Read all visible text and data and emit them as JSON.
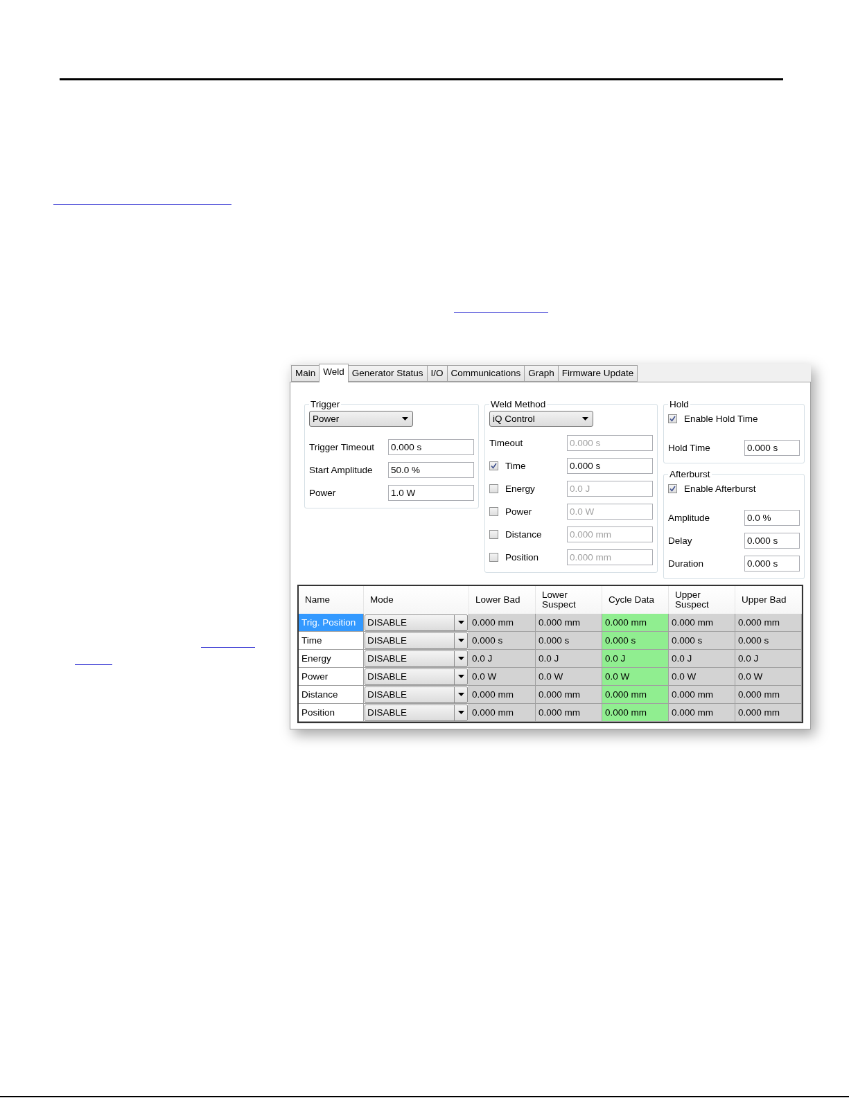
{
  "tabs": [
    {
      "label": "Main",
      "selected": false
    },
    {
      "label": "Weld",
      "selected": true
    },
    {
      "label": "Generator Status",
      "selected": false
    },
    {
      "label": "I/O",
      "selected": false
    },
    {
      "label": "Communications",
      "selected": false
    },
    {
      "label": "Graph",
      "selected": false
    },
    {
      "label": "Firmware Update",
      "selected": false
    }
  ],
  "trigger": {
    "title": "Trigger",
    "dropdown": "Power",
    "fields": [
      {
        "label": "Trigger Timeout",
        "value": "0.000 s"
      },
      {
        "label": "Start Amplitude",
        "value": "50.0 %"
      },
      {
        "label": "Power",
        "value": "1.0 W"
      }
    ]
  },
  "weld_method": {
    "title": "Weld Method",
    "dropdown": "iQ Control",
    "timeout": {
      "label": "Timeout",
      "value": "0.000 s",
      "disabled": true
    },
    "options": [
      {
        "label": "Time",
        "checked": true,
        "value": "0.000 s"
      },
      {
        "label": "Energy",
        "checked": false,
        "value": "0.0 J"
      },
      {
        "label": "Power",
        "checked": false,
        "value": "0.0 W"
      },
      {
        "label": "Distance",
        "checked": false,
        "value": "0.000 mm"
      },
      {
        "label": "Position",
        "checked": false,
        "value": "0.000 mm"
      }
    ]
  },
  "hold": {
    "title": "Hold",
    "checkbox": {
      "label": "Enable Hold Time",
      "checked": true
    },
    "fields": [
      {
        "label": "Hold Time",
        "value": "0.000 s"
      }
    ]
  },
  "afterburst": {
    "title": "Afterburst",
    "checkbox": {
      "label": "Enable Afterburst",
      "checked": true
    },
    "fields": [
      {
        "label": "Amplitude",
        "value": "0.0 %"
      },
      {
        "label": "Delay",
        "value": "0.000 s"
      },
      {
        "label": "Duration",
        "value": "0.000 s"
      }
    ]
  },
  "table": {
    "columns": [
      {
        "label": "Name",
        "kind": "name"
      },
      {
        "label": "Mode",
        "kind": "mode"
      },
      {
        "label": "Lower Bad",
        "kind": "value",
        "highlighted": false
      },
      {
        "label": "Lower Suspect",
        "kind": "value",
        "highlighted": false
      },
      {
        "label": "Cycle Data",
        "kind": "value",
        "highlighted": true
      },
      {
        "label": "Upper Suspect",
        "kind": "value",
        "highlighted": false
      },
      {
        "label": "Upper Bad",
        "kind": "value",
        "highlighted": false
      }
    ],
    "rows": [
      {
        "selected": true,
        "cells": [
          "Trig. Position",
          "DISABLE",
          "0.000 mm",
          "0.000 mm",
          "0.000 mm",
          "0.000 mm",
          "0.000 mm"
        ]
      },
      {
        "selected": false,
        "cells": [
          "Time",
          "DISABLE",
          "0.000 s",
          "0.000 s",
          "0.000 s",
          "0.000 s",
          "0.000 s"
        ]
      },
      {
        "selected": false,
        "cells": [
          "Energy",
          "DISABLE",
          "0.0 J",
          "0.0 J",
          "0.0 J",
          "0.0 J",
          "0.0 J"
        ]
      },
      {
        "selected": false,
        "cells": [
          "Power",
          "DISABLE",
          "0.0 W",
          "0.0 W",
          "0.0 W",
          "0.0 W",
          "0.0 W"
        ]
      },
      {
        "selected": false,
        "cells": [
          "Distance",
          "DISABLE",
          "0.000 mm",
          "0.000 mm",
          "0.000 mm",
          "0.000 mm",
          "0.000 mm"
        ]
      },
      {
        "selected": false,
        "cells": [
          "Position",
          "DISABLE",
          "0.000 mm",
          "0.000 mm",
          "0.000 mm",
          "0.000 mm",
          "0.000 mm"
        ]
      }
    ]
  }
}
